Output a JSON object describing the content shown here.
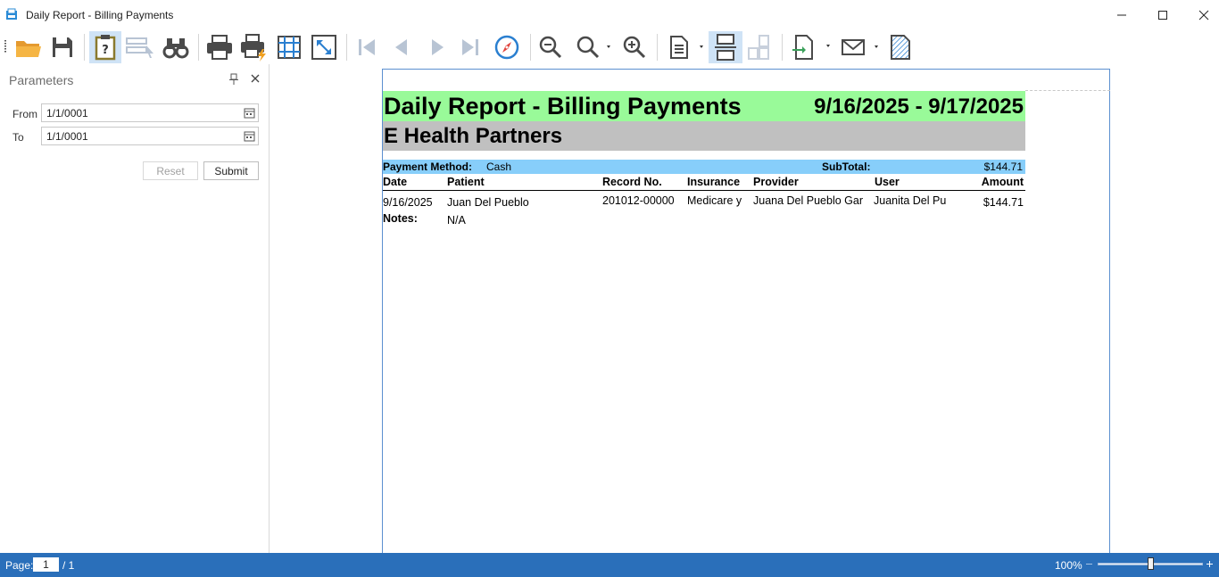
{
  "window": {
    "title": "Daily Report - Billing Payments"
  },
  "toolbar": {
    "buttons": [
      {
        "icon": "open-folder-icon"
      },
      {
        "icon": "save-icon"
      },
      {
        "icon": "parameters-icon",
        "active": true
      },
      {
        "icon": "document-map-icon"
      },
      {
        "icon": "search-binoculars-icon"
      },
      {
        "icon": "print-icon"
      },
      {
        "icon": "quick-print-icon"
      },
      {
        "icon": "page-setup-icon"
      },
      {
        "icon": "scale-icon"
      },
      {
        "icon": "first-page-icon"
      },
      {
        "icon": "previous-page-icon"
      },
      {
        "icon": "next-page-icon"
      },
      {
        "icon": "last-page-icon"
      },
      {
        "icon": "navigate-icon"
      },
      {
        "icon": "zoom-out-icon"
      },
      {
        "icon": "zoom-icon"
      },
      {
        "icon": "zoom-in-icon"
      },
      {
        "icon": "single-page-icon"
      },
      {
        "icon": "continuous-page-icon",
        "active": true
      },
      {
        "icon": "multiple-pages-icon"
      },
      {
        "icon": "export-icon"
      },
      {
        "icon": "email-icon"
      },
      {
        "icon": "watermark-icon"
      }
    ]
  },
  "parameters": {
    "title": "Parameters",
    "from_label": "From",
    "from_value": "1/1/0001",
    "to_label": "To",
    "to_value": "1/1/0001",
    "reset_label": "Reset",
    "submit_label": "Submit"
  },
  "report": {
    "title": "Daily Report - Billing Payments",
    "date_range": "9/16/2025 - 9/17/2025",
    "company": "E Health Partners",
    "payment_method_label": "Payment Method:",
    "payment_method_value": "Cash",
    "subtotal_label": "SubTotal:",
    "subtotal_value": "$144.71",
    "columns": {
      "date": "Date",
      "patient": "Patient",
      "record": "Record No.",
      "insurance": "Insurance",
      "provider": "Provider",
      "user": "User",
      "amount": "Amount"
    },
    "rows": [
      {
        "date": "9/16/2025",
        "patient": "Juan Del Pueblo",
        "record": "201012-00000",
        "insurance": "Medicare y",
        "provider": "Juana Del Pueblo Gar",
        "user": "Juanita Del Pu",
        "amount": "$144.71",
        "notes_label": "Notes:",
        "notes": "N/A"
      }
    ]
  },
  "status": {
    "page_label": "Page:",
    "page_current": "1",
    "page_total": "/ 1",
    "zoom": "100%",
    "zoom_level": 0.5
  }
}
